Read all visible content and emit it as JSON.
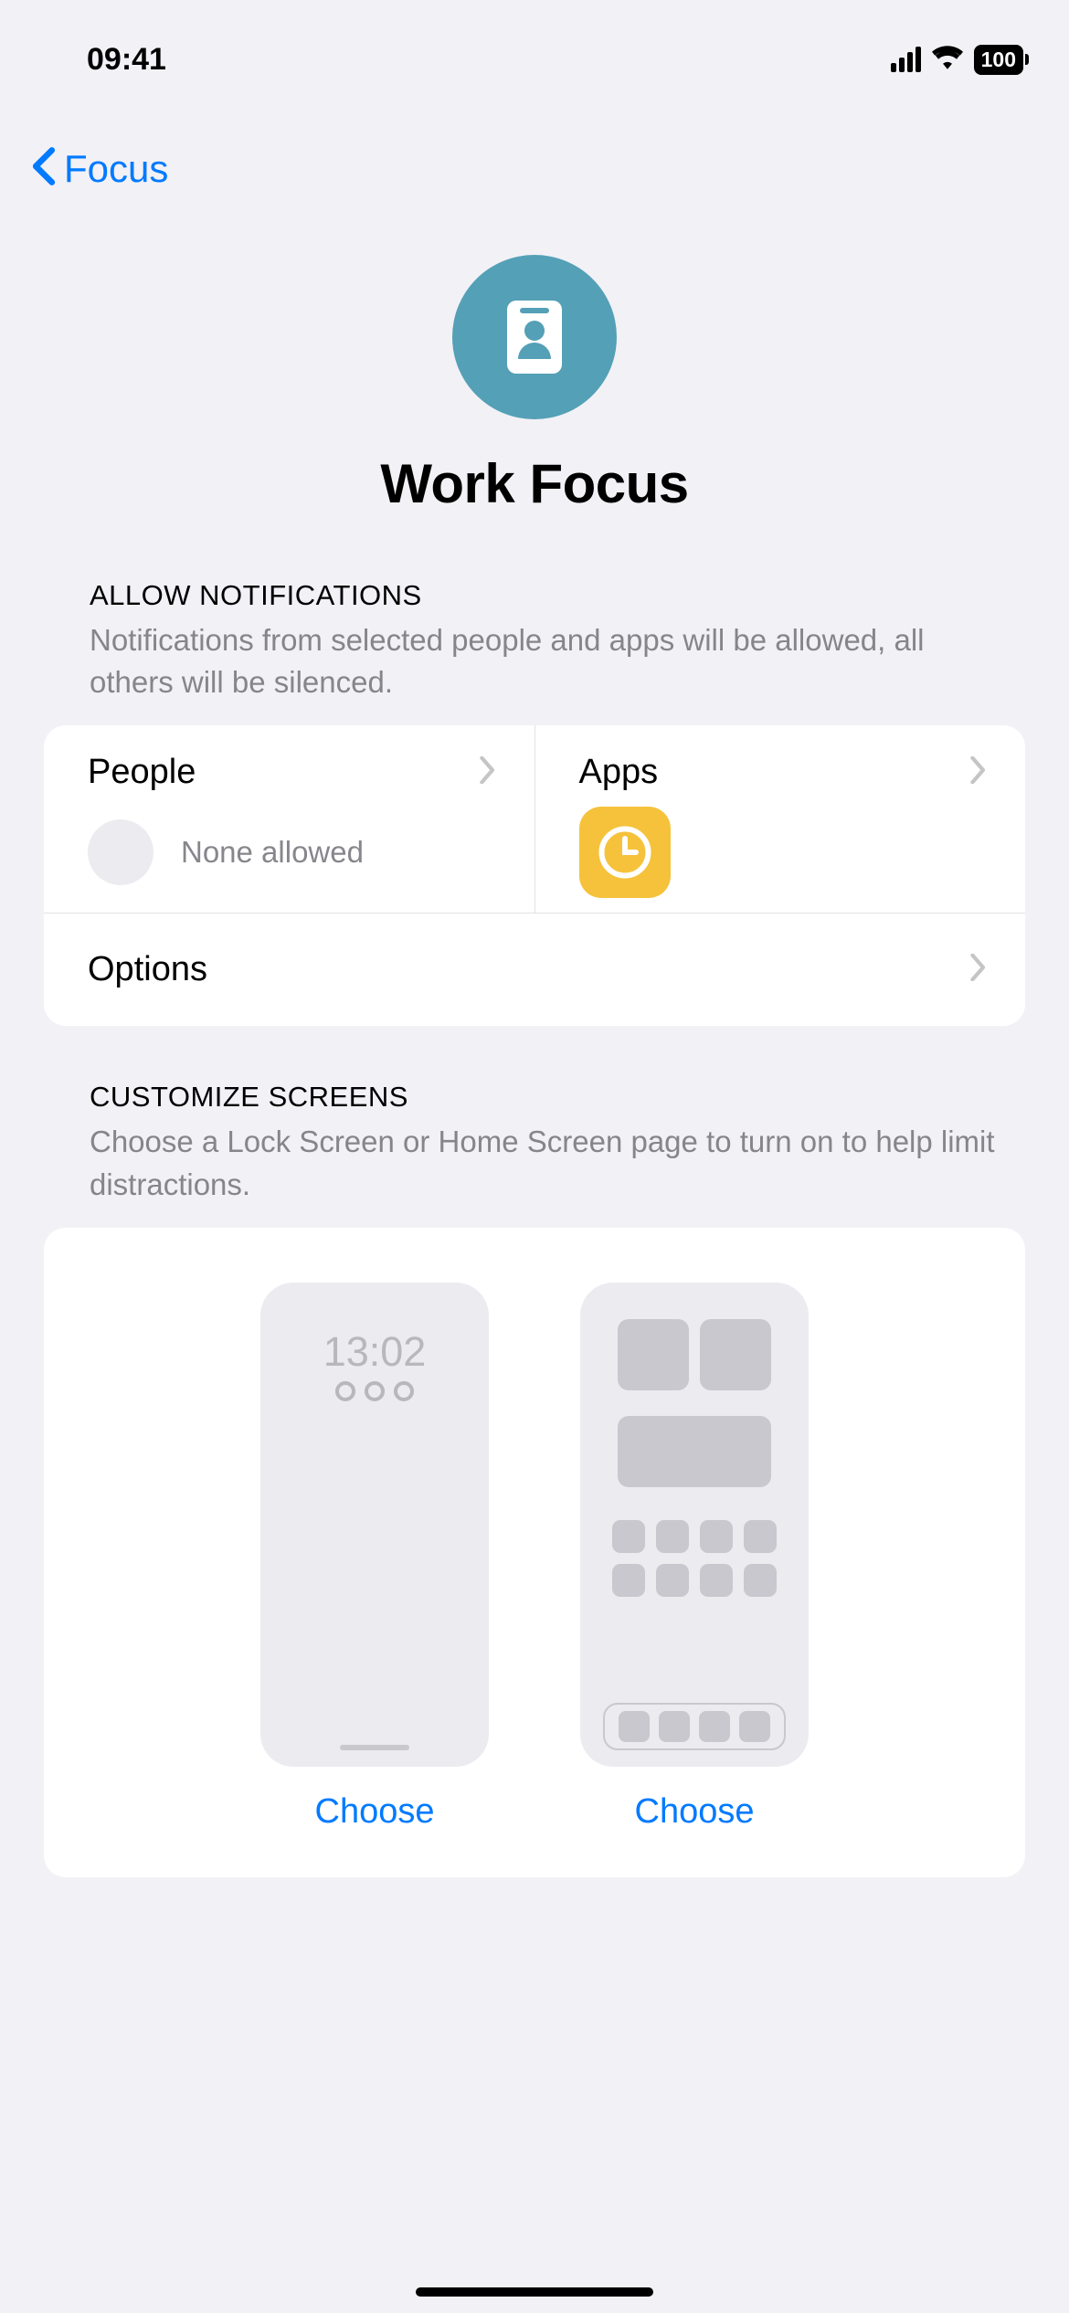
{
  "statusBar": {
    "time": "09:41",
    "battery": "100"
  },
  "nav": {
    "backLabel": "Focus"
  },
  "header": {
    "title": "Work Focus"
  },
  "allowNotifications": {
    "sectionTitle": "ALLOW NOTIFICATIONS",
    "description": "Notifications from selected people and apps will be allowed, all others will be silenced.",
    "people": {
      "label": "People",
      "status": "None allowed"
    },
    "apps": {
      "label": "Apps",
      "appIcon": "clock-app"
    },
    "optionsLabel": "Options"
  },
  "customizeScreens": {
    "sectionTitle": "CUSTOMIZE SCREENS",
    "description": "Choose a Lock Screen or Home Screen page to turn on to help limit distractions.",
    "lockScreen": {
      "time": "13:02",
      "button": "Choose"
    },
    "homeScreen": {
      "button": "Choose"
    }
  },
  "nextSection": {
    "title": ""
  }
}
